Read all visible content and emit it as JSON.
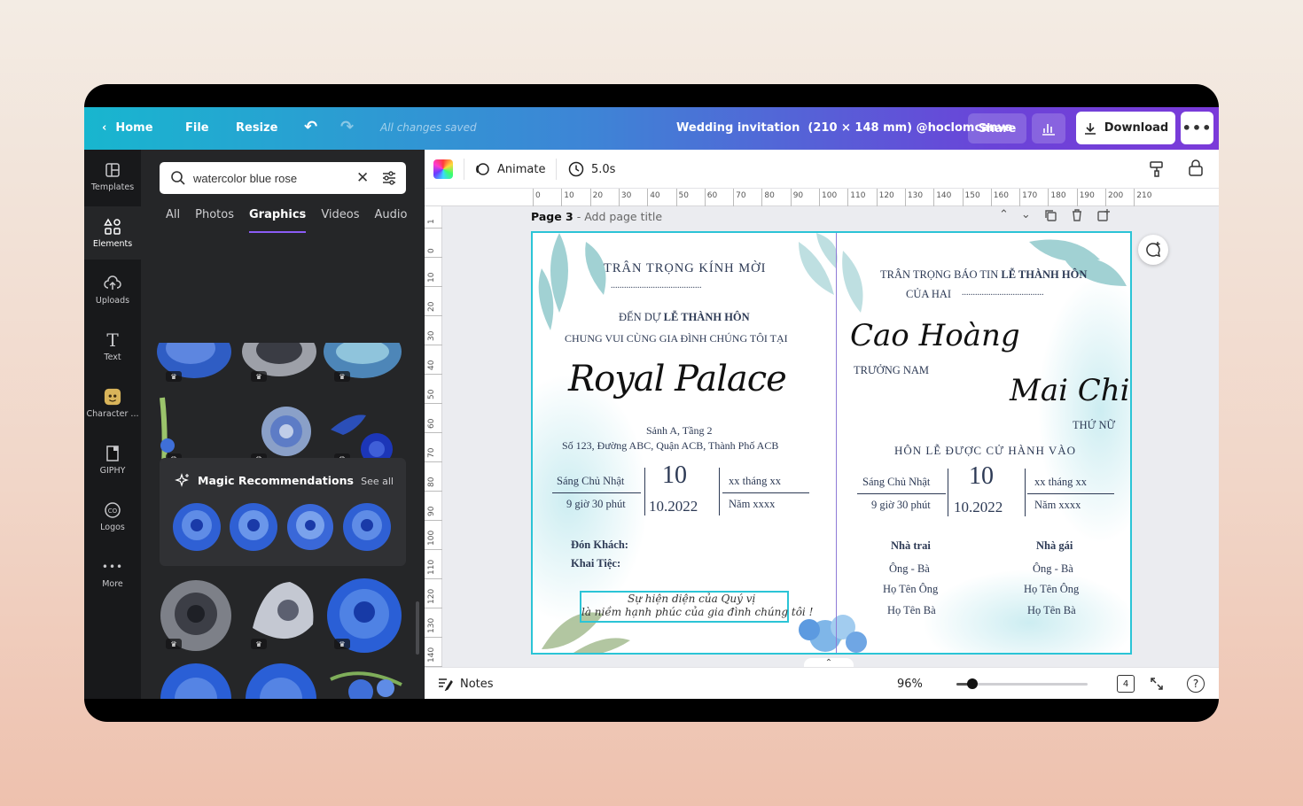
{
  "topbar": {
    "home": "Home",
    "file": "File",
    "resize": "Resize",
    "status": "All changes saved",
    "doc_title": "Wedding invitation",
    "doc_size": "(210 × 148 mm)",
    "doc_owner": "@hoclomcanva",
    "share": "Share",
    "download": "Download"
  },
  "rail": [
    {
      "label": "Templates",
      "icon": "templates-icon"
    },
    {
      "label": "Elements",
      "icon": "elements-icon"
    },
    {
      "label": "Uploads",
      "icon": "upload-cloud-icon"
    },
    {
      "label": "Text",
      "icon": "text-icon"
    },
    {
      "label": "Character ...",
      "icon": "character-icon"
    },
    {
      "label": "GIPHY",
      "icon": "giphy-icon"
    },
    {
      "label": "Logos",
      "icon": "logos-icon"
    },
    {
      "label": "More",
      "icon": "more-dots-icon"
    }
  ],
  "panel": {
    "search_value": "watercolor blue rose",
    "tabs": [
      "All",
      "Photos",
      "Graphics",
      "Videos",
      "Audio"
    ],
    "active_tab": "Graphics",
    "magic_title": "Magic Recommendations",
    "see_all": "See all"
  },
  "toolbar": {
    "animate": "Animate",
    "duration": "5.0s"
  },
  "ruler": {
    "top": [
      "0",
      "10",
      "20",
      "30",
      "40",
      "50",
      "60",
      "70",
      "80",
      "90",
      "100",
      "110",
      "120",
      "130",
      "140",
      "150",
      "160",
      "170",
      "180",
      "190",
      "200",
      "210"
    ],
    "left": [
      "1",
      "0",
      "10",
      "20",
      "30",
      "40",
      "50",
      "60",
      "70",
      "80",
      "90",
      "100",
      "110",
      "120",
      "130",
      "140"
    ]
  },
  "page": {
    "label": "Page 3",
    "title_placeholder": "- Add page title"
  },
  "invite": {
    "left": {
      "l1": "TRÂN TRỌNG KÍNH MỜI",
      "l2": ".........................................",
      "l3_pre": "ĐẾN DỰ ",
      "l3_bold": "LỄ THÀNH HÔN",
      "l4": "CHUNG VUI CÙNG GIA ĐÌNH CHÚNG TÔI TẠI",
      "venue": "Royal Palace",
      "hall": "Sảnh A, Tầng 2",
      "address": "Số 123, Đường ABC, Quận ACB, Thành Phố ACB",
      "day": "Sáng Chủ Nhật",
      "time": "9 giờ 30 phút",
      "date_num": "10",
      "date_month": "10.2022",
      "lunar": "xx tháng xx",
      "lunar_year": "Năm xxxx",
      "guest": "Đón Khách:",
      "party": "Khai Tiệc:",
      "note1": "Sự hiện diện của Quý vị",
      "note2": "là niềm hạnh phúc của gia đình chúng tôi !"
    },
    "right": {
      "l1_pre": "TRÂN TRỌNG BÁO TIN ",
      "l1_bold": "LỄ THÀNH HÔN",
      "l2": "CỦA HAI",
      "l2_dots": ".....................................",
      "groom": "Cao Hoàng",
      "groom_role": "TRƯỞNG NAM",
      "bride": "Mai Chi",
      "bride_role": "THỨ NỮ",
      "ceremony": "HÔN LỄ ĐƯỢC CỬ HÀNH VÀO",
      "day": "Sáng Chủ Nhật",
      "time": "9 giờ 30 phút",
      "date_num": "10",
      "date_month": "10.2022",
      "lunar": "xx tháng xx",
      "lunar_year": "Năm xxxx",
      "groom_side": "Nhà trai",
      "bride_side": "Nhà gái",
      "parents_label": "Ông - Bà",
      "father": "Họ Tên Ông",
      "mother": "Họ Tên Bà"
    }
  },
  "bottombar": {
    "notes": "Notes",
    "zoom": "96%",
    "pages": "4",
    "zoom_level": 0.12
  },
  "colors": {
    "accent_teal": "#18b6cf",
    "accent_purple": "#7b3ad9",
    "selection": "#2bc4d6",
    "ink": "#2d3a55"
  }
}
